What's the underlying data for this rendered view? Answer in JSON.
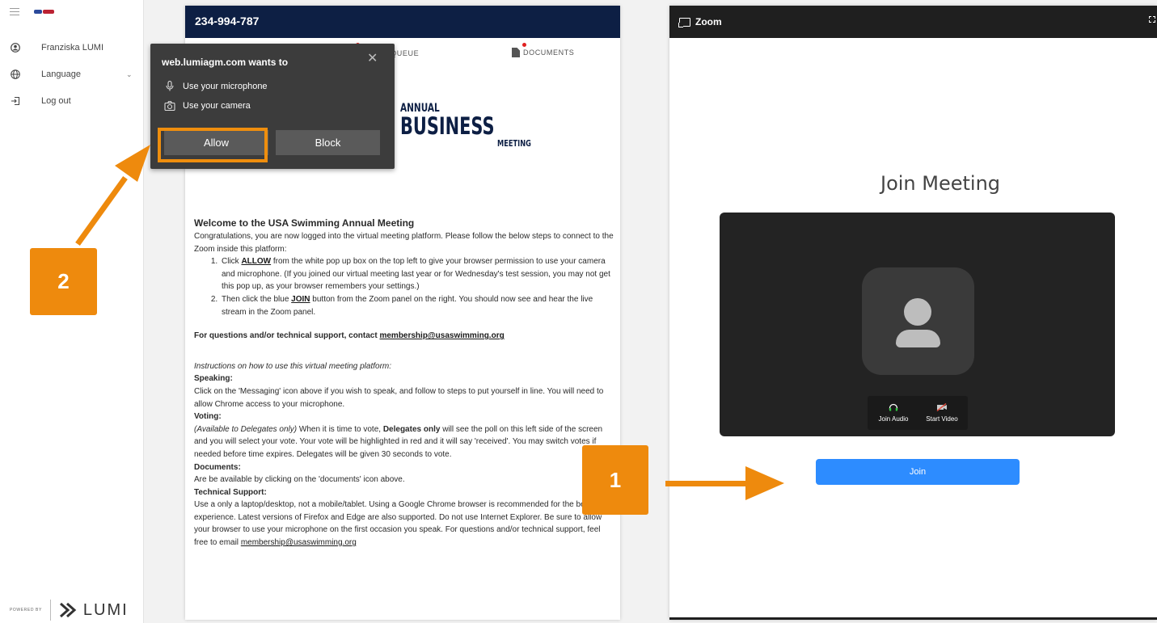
{
  "sidebar": {
    "items": [
      {
        "label": "Franziska LUMI",
        "icon": "user-icon"
      },
      {
        "label": "Language",
        "icon": "globe-icon"
      },
      {
        "label": "Log out",
        "icon": "logout-icon"
      }
    ],
    "powered_by": "POWERED BY",
    "brand": "LUMI"
  },
  "center": {
    "meeting_id": "234-994-787",
    "tabs": {
      "queue": "R QUEUE",
      "documents": "DOCUMENTS"
    },
    "logo": {
      "line1": "ANNUAL",
      "line2": "BUSINESS",
      "line3": "MEETING"
    },
    "welcome_title": "Welcome to the USA Swimming Annual Meeting",
    "intro": "Congratulations, you are now logged into the virtual meeting platform. Please follow the below steps to connect to the Zoom inside this platform:",
    "step1_pre": "Click ",
    "step1_bold": "ALLOW",
    "step1_post": " from the white pop up box on the top left to give your browser permission to use your camera and microphone. (If you joined our virtual meeting last year or for Wednesday's test session, you may not get this pop up, as your browser remembers your settings.)",
    "step2_pre": "Then click the blue ",
    "step2_bold": "JOIN",
    "step2_post": " button from the Zoom panel on the right. You should now see and hear the live stream in the Zoom panel.",
    "support_line": "For questions and/or technical support, contact ",
    "support_email": "membership@usaswimming.org",
    "instructions_title": "Instructions on how to use this virtual meeting platform:",
    "speaking_title": "Speaking:",
    "speaking_text": "Click on the 'Messaging' icon above if you wish to speak, and follow to steps to put yourself in line. You will need to allow Chrome access to your microphone.",
    "voting_title": "Voting:",
    "voting_italic": "(Available to Delegates only)",
    "voting_mid": " When it is time to vote, ",
    "voting_bold": "Delegates only",
    "voting_text": " will see the poll on this left side of the screen and you will select your vote. Your vote will be highlighted in red and it will say 'received'. You may switch votes if needed before time expires. Delegates will be given 30 seconds to vote.",
    "documents_title": "Documents:",
    "documents_text": "Are be available by clicking on the 'documents' icon above.",
    "tech_title": "Technical Support:",
    "tech_text": "Use a only a laptop/desktop, not a mobile/tablet. Using a Google Chrome browser is recommended for the best experience. Latest versions of Firefox and Edge are also supported. Do not use Internet Explorer. Be sure to allow your browser to use your microphone on the first occasion you speak. For questions and/or technical support, feel free to email ",
    "tech_email": "membership@usaswimming.org"
  },
  "permission": {
    "title": "web.lumiagm.com wants to",
    "mic": "Use your microphone",
    "camera": "Use your camera",
    "allow": "Allow",
    "block": "Block"
  },
  "zoom": {
    "title": "Zoom",
    "join_title": "Join Meeting",
    "join_audio": "Join Audio",
    "start_video": "Start Video",
    "join_button": "Join"
  },
  "annotations": {
    "badge1": "1",
    "badge2": "2",
    "color": "#ee8a0d"
  },
  "colors": {
    "header_navy": "#0d1f44",
    "zoom_blue": "#2d8cff",
    "zoom_dark": "#1f1f1f"
  }
}
